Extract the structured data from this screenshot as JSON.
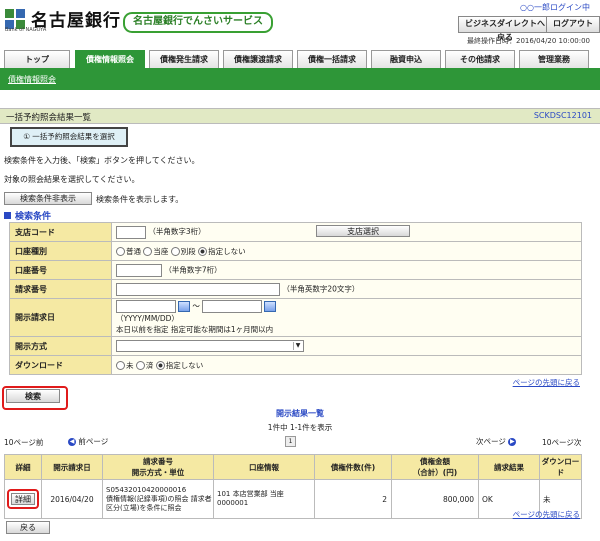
{
  "header": {
    "bank_name": "名古屋銀行",
    "bank_name_sub": "Bank of NAGOYA",
    "service_name": "名古屋銀行でんさいサービス",
    "user_label": "○○一郎ログイン中",
    "business_direct_btn": "ビジネスダイレクトへ戻る",
    "logout_btn": "ログアウト",
    "last_operation": "最終操作日時：2016/04/20 10:00:00"
  },
  "tabs": [
    {
      "label": "トップ"
    },
    {
      "label": "債権情報照会"
    },
    {
      "label": "債権発生請求"
    },
    {
      "label": "債権譲渡請求"
    },
    {
      "label": "債権一括請求"
    },
    {
      "label": "融資申込"
    },
    {
      "label": "その他請求"
    },
    {
      "label": "管理業務"
    }
  ],
  "subnav": {
    "label": "債権情報照会"
  },
  "page": {
    "title": "一括予約照会結果一覧",
    "code": "SCKDSC12101",
    "step": "① 一括予約照会結果を選択",
    "msg1": "検索条件を入力後、「検索」ボタンを押してください。",
    "msg2": "対象の照会結果を選択してください。",
    "toggle_btn": "検索条件非表示",
    "toggle_desc": "検索条件を表示します。",
    "section_title": "検索条件"
  },
  "conditions": {
    "branch_code": {
      "label": "支店コード",
      "hint": "（半角数字3桁）",
      "btn": "支店選択"
    },
    "account_type": {
      "label": "口座種別",
      "options": [
        "普通",
        "当座",
        "別段",
        "指定しない"
      ],
      "selected": 3
    },
    "account_no": {
      "label": "口座番号",
      "hint": "（半角数字7桁）"
    },
    "request_no": {
      "label": "請求番号",
      "hint": "（半角英数字20文字）"
    },
    "disclosure_date": {
      "label": "開示請求日",
      "sep": "～",
      "hint1": "（YYYY/MM/DD）",
      "hint2": "本日以前を指定 指定可能な期間は1ヶ月間以内"
    },
    "disclosure_method": {
      "label": "開示方式"
    },
    "download": {
      "label": "ダウンロード",
      "options": [
        "未",
        "済",
        "指定しない"
      ],
      "selected": 2
    }
  },
  "page_top_link": "ページの先頭に戻る",
  "search_btn": "検索",
  "results": {
    "title": "開示結果一覧",
    "count": "1件中 1-1件を表示",
    "prev10": "10ページ前",
    "prev": "前ページ",
    "page": "1",
    "next": "次ページ",
    "next10": "10ページ次",
    "headers": [
      "詳細",
      "開示請求日",
      "請求番号\n開示方式・単位",
      "口座情報",
      "債権件数(件)",
      "債権金額\n（合計）(円)",
      "請求結果",
      "ダウンロード"
    ],
    "rows": [
      {
        "detail_btn": "詳細",
        "date": "2016/04/20",
        "request_no": "S05432010420000016",
        "method": "債権情報(記録事項)の照会 請求者区分(立場)を条件に照会",
        "account": "101 本店営業部 当座 0000001",
        "count": "2",
        "amount": "800,000",
        "result": "OK",
        "download": "未"
      }
    ]
  },
  "back_btn": "戻る",
  "colors": {
    "green": "#2e9638",
    "link": "#2a49c4",
    "header_bg": "#f5e9a3",
    "highlight": "#e01b1b"
  }
}
